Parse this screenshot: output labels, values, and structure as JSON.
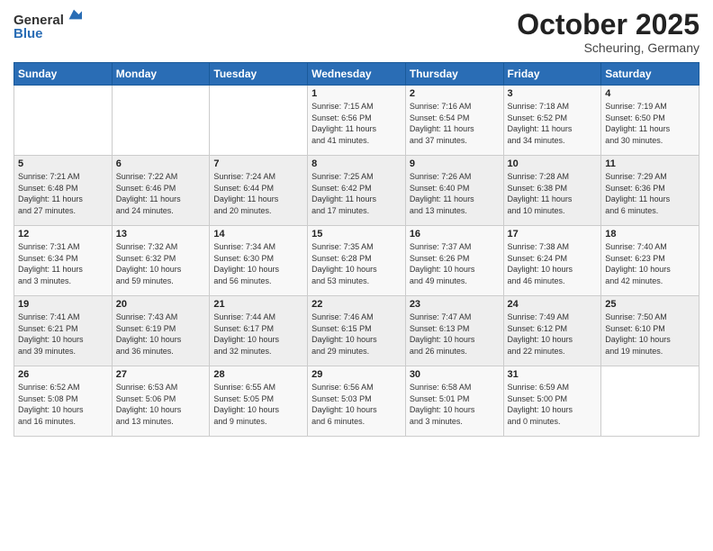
{
  "header": {
    "logo": {
      "general": "General",
      "blue": "Blue"
    },
    "title": "October 2025",
    "location": "Scheuring, Germany"
  },
  "weekdays": [
    "Sunday",
    "Monday",
    "Tuesday",
    "Wednesday",
    "Thursday",
    "Friday",
    "Saturday"
  ],
  "weeks": [
    [
      {
        "day": "",
        "info": ""
      },
      {
        "day": "",
        "info": ""
      },
      {
        "day": "",
        "info": ""
      },
      {
        "day": "1",
        "info": "Sunrise: 7:15 AM\nSunset: 6:56 PM\nDaylight: 11 hours\nand 41 minutes."
      },
      {
        "day": "2",
        "info": "Sunrise: 7:16 AM\nSunset: 6:54 PM\nDaylight: 11 hours\nand 37 minutes."
      },
      {
        "day": "3",
        "info": "Sunrise: 7:18 AM\nSunset: 6:52 PM\nDaylight: 11 hours\nand 34 minutes."
      },
      {
        "day": "4",
        "info": "Sunrise: 7:19 AM\nSunset: 6:50 PM\nDaylight: 11 hours\nand 30 minutes."
      }
    ],
    [
      {
        "day": "5",
        "info": "Sunrise: 7:21 AM\nSunset: 6:48 PM\nDaylight: 11 hours\nand 27 minutes."
      },
      {
        "day": "6",
        "info": "Sunrise: 7:22 AM\nSunset: 6:46 PM\nDaylight: 11 hours\nand 24 minutes."
      },
      {
        "day": "7",
        "info": "Sunrise: 7:24 AM\nSunset: 6:44 PM\nDaylight: 11 hours\nand 20 minutes."
      },
      {
        "day": "8",
        "info": "Sunrise: 7:25 AM\nSunset: 6:42 PM\nDaylight: 11 hours\nand 17 minutes."
      },
      {
        "day": "9",
        "info": "Sunrise: 7:26 AM\nSunset: 6:40 PM\nDaylight: 11 hours\nand 13 minutes."
      },
      {
        "day": "10",
        "info": "Sunrise: 7:28 AM\nSunset: 6:38 PM\nDaylight: 11 hours\nand 10 minutes."
      },
      {
        "day": "11",
        "info": "Sunrise: 7:29 AM\nSunset: 6:36 PM\nDaylight: 11 hours\nand 6 minutes."
      }
    ],
    [
      {
        "day": "12",
        "info": "Sunrise: 7:31 AM\nSunset: 6:34 PM\nDaylight: 11 hours\nand 3 minutes."
      },
      {
        "day": "13",
        "info": "Sunrise: 7:32 AM\nSunset: 6:32 PM\nDaylight: 10 hours\nand 59 minutes."
      },
      {
        "day": "14",
        "info": "Sunrise: 7:34 AM\nSunset: 6:30 PM\nDaylight: 10 hours\nand 56 minutes."
      },
      {
        "day": "15",
        "info": "Sunrise: 7:35 AM\nSunset: 6:28 PM\nDaylight: 10 hours\nand 53 minutes."
      },
      {
        "day": "16",
        "info": "Sunrise: 7:37 AM\nSunset: 6:26 PM\nDaylight: 10 hours\nand 49 minutes."
      },
      {
        "day": "17",
        "info": "Sunrise: 7:38 AM\nSunset: 6:24 PM\nDaylight: 10 hours\nand 46 minutes."
      },
      {
        "day": "18",
        "info": "Sunrise: 7:40 AM\nSunset: 6:23 PM\nDaylight: 10 hours\nand 42 minutes."
      }
    ],
    [
      {
        "day": "19",
        "info": "Sunrise: 7:41 AM\nSunset: 6:21 PM\nDaylight: 10 hours\nand 39 minutes."
      },
      {
        "day": "20",
        "info": "Sunrise: 7:43 AM\nSunset: 6:19 PM\nDaylight: 10 hours\nand 36 minutes."
      },
      {
        "day": "21",
        "info": "Sunrise: 7:44 AM\nSunset: 6:17 PM\nDaylight: 10 hours\nand 32 minutes."
      },
      {
        "day": "22",
        "info": "Sunrise: 7:46 AM\nSunset: 6:15 PM\nDaylight: 10 hours\nand 29 minutes."
      },
      {
        "day": "23",
        "info": "Sunrise: 7:47 AM\nSunset: 6:13 PM\nDaylight: 10 hours\nand 26 minutes."
      },
      {
        "day": "24",
        "info": "Sunrise: 7:49 AM\nSunset: 6:12 PM\nDaylight: 10 hours\nand 22 minutes."
      },
      {
        "day": "25",
        "info": "Sunrise: 7:50 AM\nSunset: 6:10 PM\nDaylight: 10 hours\nand 19 minutes."
      }
    ],
    [
      {
        "day": "26",
        "info": "Sunrise: 6:52 AM\nSunset: 5:08 PM\nDaylight: 10 hours\nand 16 minutes."
      },
      {
        "day": "27",
        "info": "Sunrise: 6:53 AM\nSunset: 5:06 PM\nDaylight: 10 hours\nand 13 minutes."
      },
      {
        "day": "28",
        "info": "Sunrise: 6:55 AM\nSunset: 5:05 PM\nDaylight: 10 hours\nand 9 minutes."
      },
      {
        "day": "29",
        "info": "Sunrise: 6:56 AM\nSunset: 5:03 PM\nDaylight: 10 hours\nand 6 minutes."
      },
      {
        "day": "30",
        "info": "Sunrise: 6:58 AM\nSunset: 5:01 PM\nDaylight: 10 hours\nand 3 minutes."
      },
      {
        "day": "31",
        "info": "Sunrise: 6:59 AM\nSunset: 5:00 PM\nDaylight: 10 hours\nand 0 minutes."
      },
      {
        "day": "",
        "info": ""
      }
    ]
  ]
}
